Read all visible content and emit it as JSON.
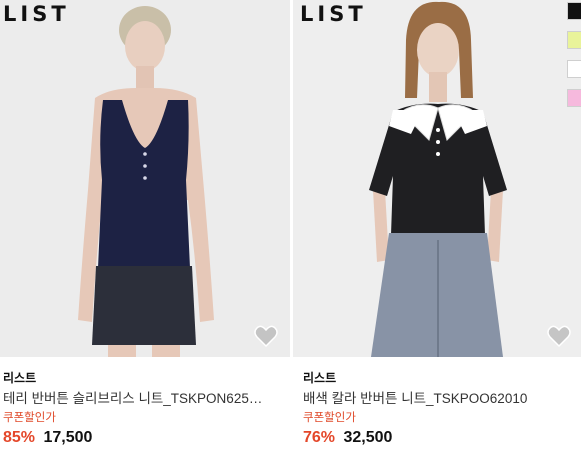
{
  "products": [
    {
      "logo": "LIST",
      "brand": "리스트",
      "name": "테리 반버튼 슬리브리스 니트_TSKPON625…",
      "coupon": "쿠폰할인가",
      "discount": "85%",
      "price": "17,500",
      "wishlist_icon": "heart-icon",
      "colors": {
        "top": "#1d2244",
        "skirt": "#2c2f3a",
        "background": "#ececec"
      }
    },
    {
      "logo": "LIST",
      "brand": "리스트",
      "name": "배색 칼라 반버튼 니트_TSKPOO62010",
      "coupon": "쿠폰할인가",
      "discount": "76%",
      "price": "32,500",
      "wishlist_icon": "heart-icon",
      "colors": {
        "top": "#1f1f22",
        "collar": "#ffffff",
        "jeans": "#8893a6",
        "background": "#eeeeee"
      },
      "color_swatches": [
        "#111111",
        "#e9f39a",
        "#ffffff",
        "#f6b9dd"
      ]
    }
  ]
}
